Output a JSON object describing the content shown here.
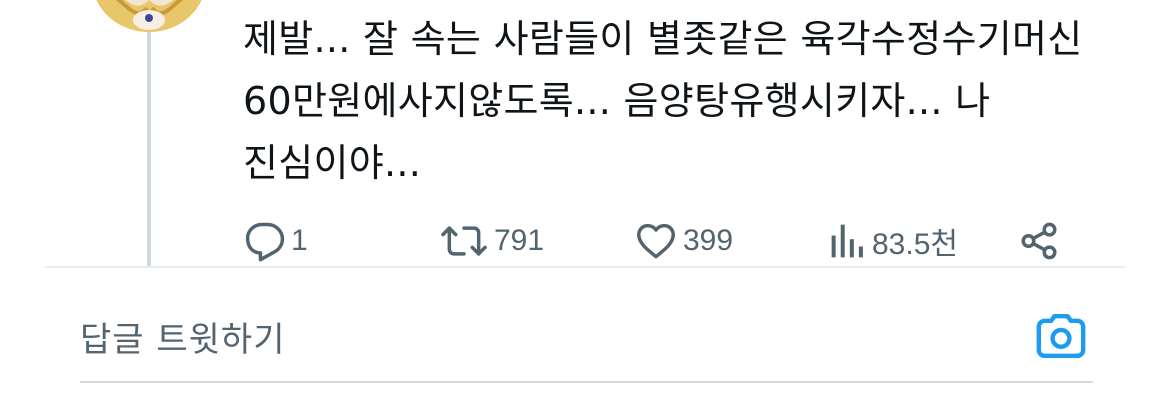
{
  "tweet": {
    "text": "제발... 잘 속는 사람들이 별좃같은 육각수정수기머신\n60만원에사지않도록... 음양탕유행시키자... 나\n진심이야..."
  },
  "actions": {
    "reply": {
      "icon": "reply-icon",
      "count": "1"
    },
    "retweet": {
      "icon": "retweet-icon",
      "count": "791"
    },
    "like": {
      "icon": "heart-icon",
      "count": "399"
    },
    "views": {
      "icon": "views-icon",
      "count": "83.5천"
    },
    "share": {
      "icon": "share-icon"
    }
  },
  "reply_box": {
    "placeholder": "답글 트윗하기",
    "camera_icon": "camera-icon"
  },
  "colors": {
    "text": "#0f1419",
    "muted": "#536471",
    "accent": "#1d9bf0",
    "thread_line": "#cfd9de"
  }
}
